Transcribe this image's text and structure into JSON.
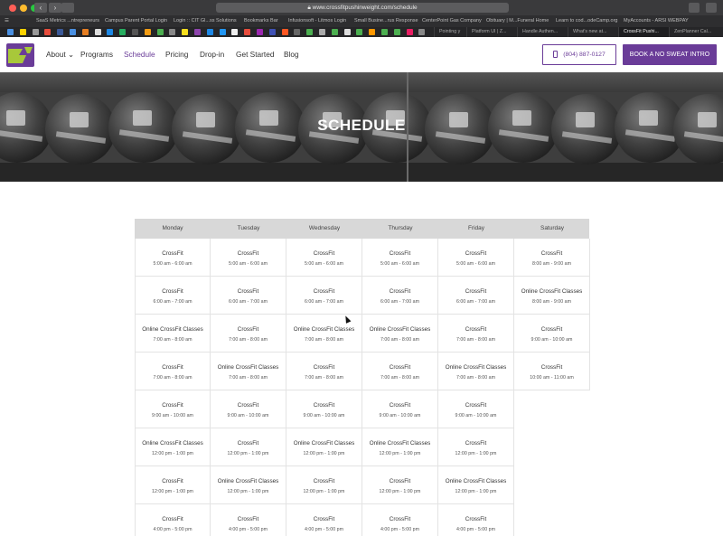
{
  "browser": {
    "url": "www.crossfitpushinweight.com/schedule",
    "bookmarks": [
      "SaaS Metrics ...ntrepreneurs",
      "Campus Parent Portal Login",
      "Login :: CIT Gl...ss Solutions",
      "Bookmarks Bar",
      "Infusionsoft - Litmos Login",
      "Small Busine...rus Response",
      "CenterPoint Gas Company",
      "Obituary | M...Funeral Home",
      "Learn to cod...odeCamp.org",
      "MyAccounts - ARSI WEBPAY"
    ],
    "tabs": [
      "Pointing y",
      "Platform UI | Z...",
      "Handle Authen...",
      "What's new at...",
      "CrossFit Pushi...",
      "ZenPlanner Cal..."
    ],
    "active_tab_index": 4,
    "favicon_colors": [
      "#4a90e2",
      "#ffd400",
      "#999",
      "#e74c3c",
      "#3b5998",
      "#4a90e2",
      "#e67e22",
      "#ddd",
      "#1e88e5",
      "#27ae60",
      "#555",
      "#f39c12",
      "#4caf50",
      "#888",
      "#f7df1e",
      "#8e44ad",
      "#1e88e5",
      "#2196f3",
      "#eee",
      "#e74c3c",
      "#9c27b0",
      "#3f51b5",
      "#ff5722",
      "#666",
      "#4caf50",
      "#aaa",
      "#4caf50",
      "#ddd",
      "#4caf50",
      "#ff9800",
      "#4caf50",
      "#4caf50",
      "#e91e63",
      "#888"
    ]
  },
  "site": {
    "nav": {
      "about": "About",
      "programs": "Programs",
      "schedule": "Schedule",
      "pricing": "Pricing",
      "dropin": "Drop-in",
      "get_started": "Get Started",
      "blog": "Blog"
    },
    "phone": "(804) 887-0127",
    "cta": "BOOK A NO SWEAT INTRO",
    "hero_title": "SCHEDULE",
    "colors": {
      "brand_purple": "#6a3c98",
      "logo_green": "#a8c83a"
    },
    "schedule": {
      "days": [
        "Monday",
        "Tuesday",
        "Wednesday",
        "Thursday",
        "Friday",
        "Saturday"
      ],
      "rows": [
        [
          [
            "CrossFit",
            "5:00 am - 6:00 am"
          ],
          [
            "CrossFit",
            "5:00 am - 6:00 am"
          ],
          [
            "CrossFit",
            "5:00 am - 6:00 am"
          ],
          [
            "CrossFit",
            "5:00 am - 6:00 am"
          ],
          [
            "CrossFit",
            "5:00 am - 6:00 am"
          ],
          [
            "CrossFit",
            "8:00 am - 9:00 am"
          ]
        ],
        [
          [
            "CrossFit",
            "6:00 am - 7:00 am"
          ],
          [
            "CrossFit",
            "6:00 am - 7:00 am"
          ],
          [
            "CrossFit",
            "6:00 am - 7:00 am"
          ],
          [
            "CrossFit",
            "6:00 am - 7:00 am"
          ],
          [
            "CrossFit",
            "6:00 am - 7:00 am"
          ],
          [
            "Online CrossFit Classes",
            "8:00 am - 9:00 am"
          ]
        ],
        [
          [
            "Online CrossFit Classes",
            "7:00 am - 8:00 am"
          ],
          [
            "CrossFit",
            "7:00 am - 8:00 am"
          ],
          [
            "Online CrossFit Classes",
            "7:00 am - 8:00 am"
          ],
          [
            "Online CrossFit Classes",
            "7:00 am - 8:00 am"
          ],
          [
            "CrossFit",
            "7:00 am - 8:00 am"
          ],
          [
            "CrossFit",
            "9:00 am - 10:00 am"
          ]
        ],
        [
          [
            "CrossFit",
            "7:00 am - 8:00 am"
          ],
          [
            "Online CrossFit Classes",
            "7:00 am - 8:00 am"
          ],
          [
            "CrossFit",
            "7:00 am - 8:00 am"
          ],
          [
            "CrossFit",
            "7:00 am - 8:00 am"
          ],
          [
            "Online CrossFit Classes",
            "7:00 am - 8:00 am"
          ],
          [
            "CrossFit",
            "10:00 am - 11:00 am"
          ]
        ],
        [
          [
            "CrossFit",
            "9:00 am - 10:00 am"
          ],
          [
            "CrossFit",
            "9:00 am - 10:00 am"
          ],
          [
            "CrossFit",
            "9:00 am - 10:00 am"
          ],
          [
            "CrossFit",
            "9:00 am - 10:00 am"
          ],
          [
            "CrossFit",
            "9:00 am - 10:00 am"
          ],
          null
        ],
        [
          [
            "Online CrossFit Classes",
            "12:00 pm - 1:00 pm"
          ],
          [
            "CrossFit",
            "12:00 pm - 1:00 pm"
          ],
          [
            "Online CrossFit Classes",
            "12:00 pm - 1:00 pm"
          ],
          [
            "Online CrossFit Classes",
            "12:00 pm - 1:00 pm"
          ],
          [
            "CrossFit",
            "12:00 pm - 1:00 pm"
          ],
          null
        ],
        [
          [
            "CrossFit",
            "12:00 pm - 1:00 pm"
          ],
          [
            "Online CrossFit Classes",
            "12:00 pm - 1:00 pm"
          ],
          [
            "CrossFit",
            "12:00 pm - 1:00 pm"
          ],
          [
            "CrossFit",
            "12:00 pm - 1:00 pm"
          ],
          [
            "Online CrossFit Classes",
            "12:00 pm - 1:00 pm"
          ],
          null
        ],
        [
          [
            "CrossFit",
            "4:00 pm - 5:00 pm"
          ],
          [
            "CrossFit",
            "4:00 pm - 5:00 pm"
          ],
          [
            "CrossFit",
            "4:00 pm - 5:00 pm"
          ],
          [
            "CrossFit",
            "4:00 pm - 5:00 pm"
          ],
          [
            "CrossFit",
            "4:00 pm - 5:00 pm"
          ],
          null
        ]
      ]
    }
  }
}
